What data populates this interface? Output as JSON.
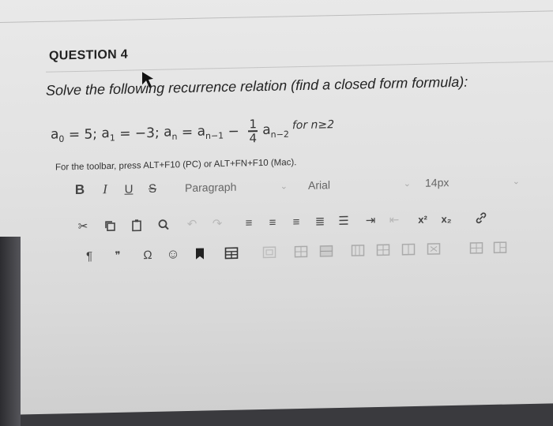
{
  "question": {
    "title": "QUESTION 4",
    "prompt": "Solve the following recurrence relation (find a closed form formula):"
  },
  "formula": {
    "a0": "a",
    "a0_sub": "0",
    "a0_val": " = 5; ",
    "a1": "a",
    "a1_sub": "1",
    "a1_val": " = −3; ",
    "an": "a",
    "an_sub": "n",
    "eq": " = ",
    "an1": "a",
    "an1_sub": "n−1",
    "minus": " − ",
    "frac_num": "1",
    "frac_den": "4",
    "an2": "a",
    "an2_sub": "n−2",
    "condition": "for n≥2"
  },
  "editor": {
    "hint": "For the toolbar, press ALT+F10 (PC) or ALT+FN+F10 (Mac).",
    "bold": "B",
    "italic": "I",
    "underline": "U",
    "strike": "S",
    "block_format": "Paragraph",
    "font_family": "Arial",
    "font_size": "14px",
    "superscript": "x²",
    "subscript": "x₂",
    "pilcrow": "¶",
    "quote": "❞",
    "omega": "Ω",
    "emoji": "☺"
  }
}
